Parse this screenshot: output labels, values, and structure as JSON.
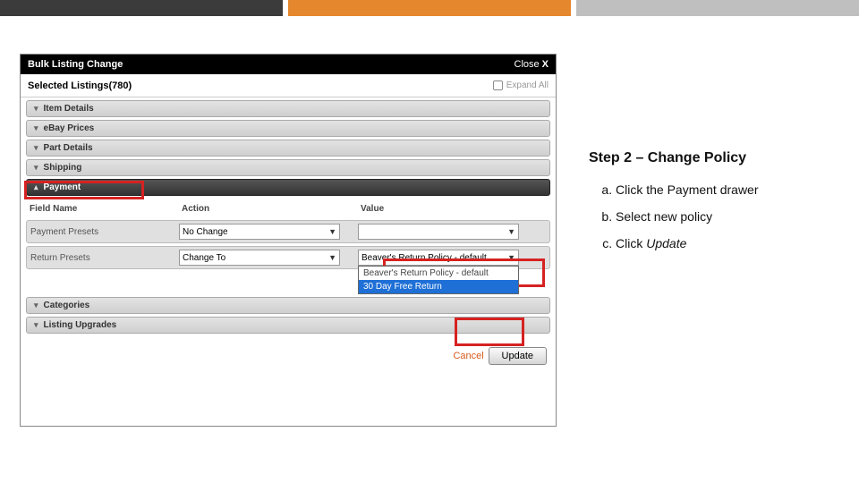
{
  "colors": {
    "accent": "#e5872c",
    "dark": "#3b3b3b",
    "light": "#bfbfbf",
    "red": "#d62222",
    "link": "#d85a1c"
  },
  "dialog": {
    "title": "Bulk Listing Change",
    "close": "Close",
    "selected_listings": "Selected Listings(780)",
    "expand_all": "Expand All"
  },
  "drawers": {
    "item_details": "Item Details",
    "ebay_prices": "eBay Prices",
    "part_details": "Part Details",
    "shipping": "Shipping",
    "payment": "Payment",
    "categories": "Categories",
    "listing_upgrades": "Listing Upgrades"
  },
  "grid": {
    "heads": {
      "field": "Field Name",
      "action": "Action",
      "value": "Value"
    },
    "row1": {
      "field": "Payment Presets",
      "action": "No Change",
      "value": ""
    },
    "row2": {
      "field": "Return Presets",
      "action": "Change To",
      "value_display": "Beaver's Return Policy - default",
      "dropdown": {
        "opt_default": "Beaver's Return Policy - default",
        "opt_highlight": "30 Day Free Return"
      }
    }
  },
  "actions": {
    "cancel": "Cancel",
    "update": "Update"
  },
  "instructions": {
    "title": "Step 2 – Change Policy",
    "a": "Click the Payment drawer",
    "b": "Select new policy",
    "c_prefix": "Click ",
    "c_em": "Update"
  }
}
